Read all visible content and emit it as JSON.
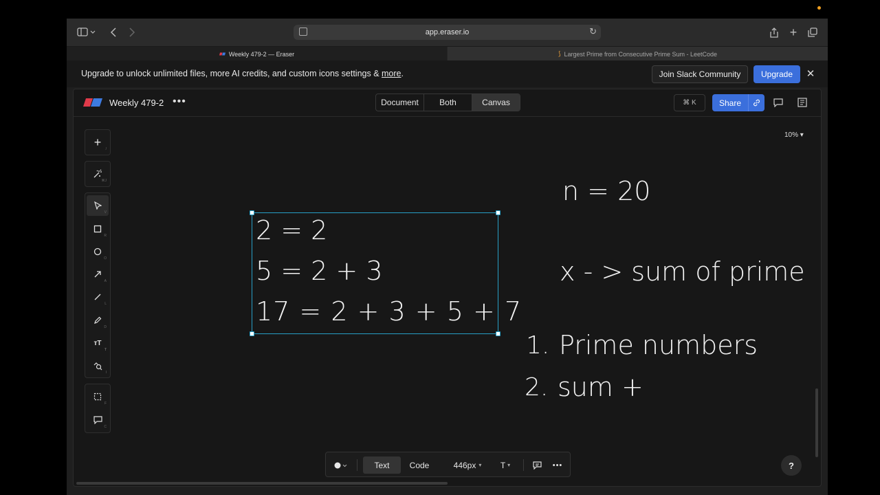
{
  "browser": {
    "url": "app.eraser.io",
    "tabs": [
      {
        "label": "Weekly 479-2 — Eraser",
        "active": true
      },
      {
        "label": "Largest Prime from Consecutive Prime Sum - LeetCode",
        "active": false
      }
    ]
  },
  "banner": {
    "text": "Upgrade to unlock unlimited files, more AI credits, and custom icons settings & ",
    "link": "more",
    "period": ".",
    "slack_button": "Join Slack Community",
    "upgrade_button": "Upgrade",
    "close": "✕"
  },
  "header": {
    "title": "Weekly 479-2",
    "more": "•••",
    "views": [
      "Document",
      "Both",
      "Canvas"
    ],
    "active_view": "Canvas",
    "shortcut": "⌘ K",
    "share": "Share"
  },
  "canvas": {
    "zoom": "10%",
    "selected_lines": [
      "2 = 2",
      "5 = 2 + 3",
      "17 = 2 + 3 + 5 + 7"
    ],
    "n_line": "n = 20",
    "x_line": "x - > sum of prime",
    "list_num_1": "1.",
    "list_text_1": "Prime numbers",
    "list_num_2": "2.",
    "list_text_2": "sum +"
  },
  "bottombar": {
    "text_tab": "Text",
    "code_tab": "Code",
    "size": "446px",
    "font": "T",
    "more": "•••"
  },
  "help": "?"
}
